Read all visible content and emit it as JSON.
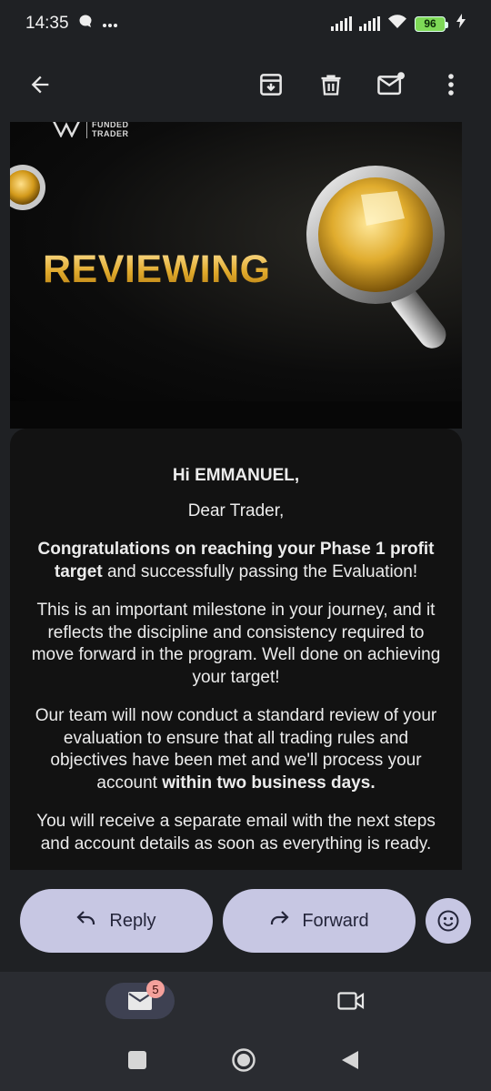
{
  "status_bar": {
    "time": "14:35",
    "battery_level": "96",
    "icons": [
      "chat-bubble-icon",
      "more-dots-icon",
      "signal-icon",
      "signal-icon",
      "wifi-icon",
      "battery-icon",
      "charging-icon"
    ]
  },
  "app_bar": {
    "icons": [
      "back-arrow-icon",
      "archive-icon",
      "delete-icon",
      "mark-unread-icon",
      "more-vert-icon"
    ]
  },
  "email": {
    "brand_logo_text_line1": "FUNDED",
    "brand_logo_text_line2": "TRADER",
    "banner_title": "REVIEWING",
    "greeting": "Hi EMMANUEL,",
    "salutation": "Dear Trader,",
    "para1_bold": "Congratulations on reaching your Phase 1 profit target",
    "para1_rest": " and successfully passing the Evaluation!",
    "para2": "This is an important milestone in your journey, and it reflects the discipline and consistency required to move forward in the program. Well done on achieving your target!",
    "para3_start": "Our team will now conduct a standard review of your evaluation to ensure that all trading rules and objectives have been met and we'll process your account ",
    "para3_bold": "within two business days.",
    "para4": "You will receive a separate email with the next steps and account details as soon as everything is ready."
  },
  "actions": {
    "reply_label": "Reply",
    "forward_label": "Forward"
  },
  "bottom_nav": {
    "mail_badge": "5"
  },
  "colors": {
    "background": "#1f2124",
    "pill": "#c7c7e3",
    "gold": "#e6b741",
    "badge": "#f4a09b"
  }
}
